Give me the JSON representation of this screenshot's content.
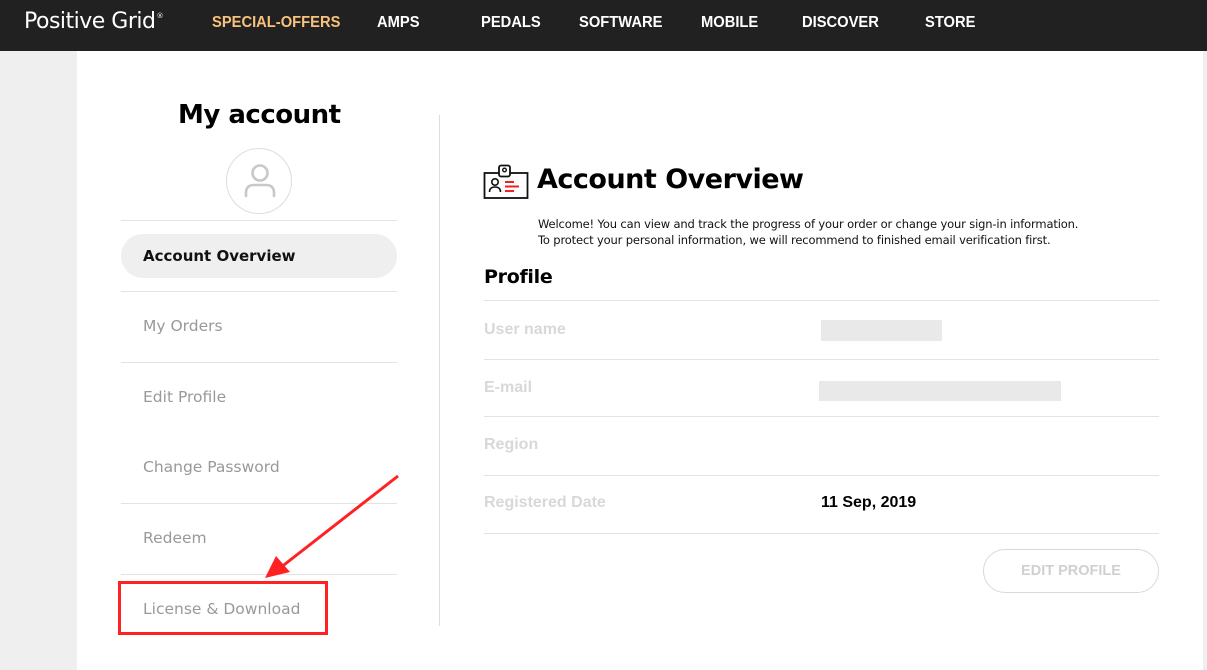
{
  "header": {
    "logo": "Positive Grid",
    "logo_mark": "®",
    "nav": [
      {
        "label": "SPECIAL-OFFERS",
        "highlight": true
      },
      {
        "label": "AMPS"
      },
      {
        "label": "PEDALS"
      },
      {
        "label": "SOFTWARE"
      },
      {
        "label": "MOBILE"
      },
      {
        "label": "DISCOVER"
      },
      {
        "label": "STORE"
      }
    ],
    "highlight_color": "#f7c27b",
    "background": "#212121"
  },
  "sidebar": {
    "title": "My account",
    "avatar_icon": "user-icon",
    "items": [
      {
        "label": "Account Overview",
        "active": true
      },
      {
        "label": "My Orders"
      },
      {
        "label": "Edit Profile"
      },
      {
        "label": "Change Password"
      },
      {
        "label": "Redeem"
      },
      {
        "label": "License & Download"
      }
    ]
  },
  "main": {
    "icon": "id-badge-icon",
    "title": "Account Overview",
    "welcome_lines": [
      "Welcome! You can view and track the progress of your order or change your sign-in information.",
      "To protect your personal information, we will recommend to finished email verification first."
    ],
    "profile": {
      "title": "Profile",
      "rows": [
        {
          "label": "User name",
          "value": "",
          "redacted": true
        },
        {
          "label": "E-mail",
          "value": "",
          "redacted": true
        },
        {
          "label": "Region",
          "value": ""
        },
        {
          "label": "Registered Date",
          "value": "11 Sep, 2019"
        }
      ],
      "edit_button": "EDIT PROFILE"
    }
  },
  "annotation": {
    "target": "License & Download",
    "color": "#ff2222"
  }
}
